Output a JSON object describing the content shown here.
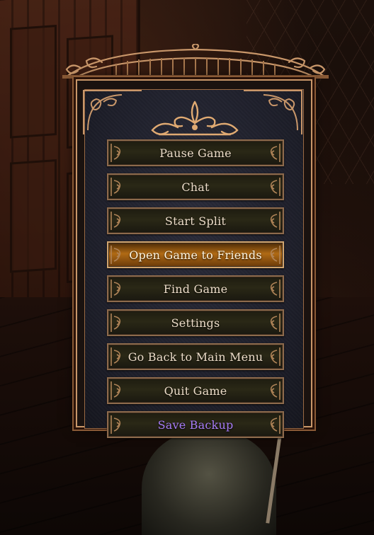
{
  "menu": {
    "items": [
      {
        "label": "Pause Game",
        "highlighted": false,
        "color": "#ecdcc8"
      },
      {
        "label": "Chat",
        "highlighted": false,
        "color": "#ecdcc8"
      },
      {
        "label": "Start Split",
        "highlighted": false,
        "color": "#ecdcc8"
      },
      {
        "label": "Open Game to Friends",
        "highlighted": true,
        "color": "#fff6e2"
      },
      {
        "label": "Find Game",
        "highlighted": false,
        "color": "#ecdcc8"
      },
      {
        "label": "Settings",
        "highlighted": false,
        "color": "#ecdcc8"
      },
      {
        "label": "Go Back to Main Menu",
        "highlighted": false,
        "color": "#ecdcc8"
      },
      {
        "label": "Quit Game",
        "highlighted": false,
        "color": "#ecdcc8"
      },
      {
        "label": "Save Backup",
        "highlighted": false,
        "color": "#a77cf7"
      }
    ]
  },
  "colors": {
    "frame_gold": "#c9976a",
    "highlight_orange": "#b06a14",
    "save_backup_purple": "#a77cf7"
  }
}
